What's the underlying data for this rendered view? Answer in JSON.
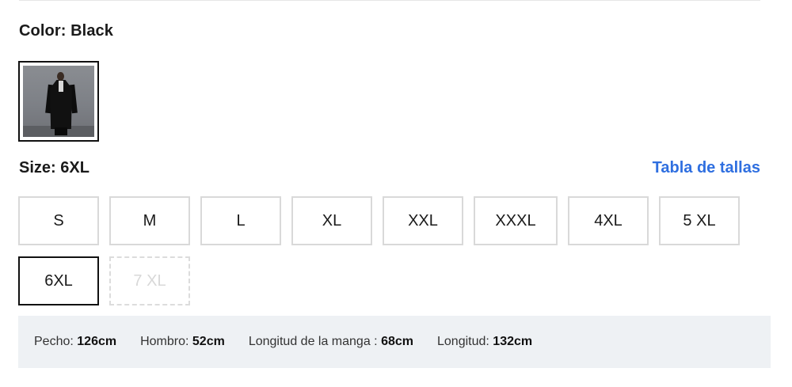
{
  "color": {
    "label": "Color: Black"
  },
  "swatches": [
    {
      "name": "Black",
      "selected": true
    }
  ],
  "size": {
    "label": "Size: 6XL",
    "chart_link": "Tabla de tallas"
  },
  "sizes": [
    {
      "label": "S",
      "state": "available"
    },
    {
      "label": "M",
      "state": "available"
    },
    {
      "label": "L",
      "state": "available"
    },
    {
      "label": "XL",
      "state": "available"
    },
    {
      "label": "XXL",
      "state": "available"
    },
    {
      "label": "XXXL",
      "state": "available"
    },
    {
      "label": "4XL",
      "state": "available"
    },
    {
      "label": "5 XL",
      "state": "available"
    },
    {
      "label": "6XL",
      "state": "selected"
    },
    {
      "label": "7 XL",
      "state": "disabled"
    }
  ],
  "measurements": [
    {
      "label": "Pecho:",
      "value": "126cm"
    },
    {
      "label": "Hombro:",
      "value": "52cm"
    },
    {
      "label": "Longitud de la manga :",
      "value": "68cm"
    },
    {
      "label": "Longitud:",
      "value": "132cm"
    }
  ],
  "colors": {
    "link": "#2f6fe0",
    "selected_border": "#111111",
    "border": "#d9d9d9",
    "measure_bg": "#eef1f4"
  }
}
